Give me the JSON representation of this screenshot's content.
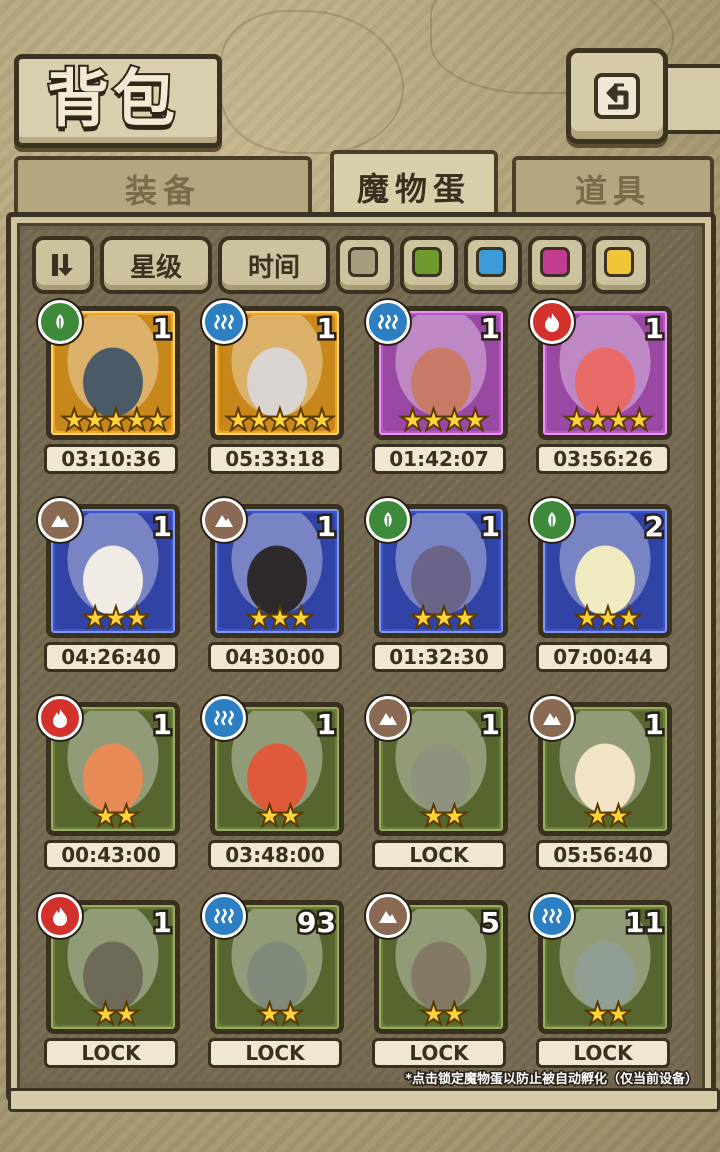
{
  "title": "背包",
  "tabs": [
    {
      "label": "装备",
      "active": false
    },
    {
      "label": "魔物蛋",
      "active": true
    },
    {
      "label": "道具",
      "active": false
    }
  ],
  "filters": {
    "sort_icon": "sort-toggle-icon",
    "star_label": "星级",
    "time_label": "时间",
    "swatches": [
      "#a89c80",
      "#6f9a2e",
      "#3d9bd8",
      "#c23c8f",
      "#f0c53a"
    ]
  },
  "eggs": [
    {
      "element": "nature",
      "rarity": "orange",
      "count": "1",
      "stars": 5,
      "timer": "03:10:36",
      "art": "#4a5a66"
    },
    {
      "element": "water",
      "rarity": "orange",
      "count": "1",
      "stars": 5,
      "timer": "05:33:18",
      "art": "#d9d4cf"
    },
    {
      "element": "water",
      "rarity": "purple",
      "count": "1",
      "stars": 4,
      "timer": "01:42:07",
      "art": "#c87a66"
    },
    {
      "element": "fire",
      "rarity": "purple",
      "count": "1",
      "stars": 4,
      "timer": "03:56:26",
      "art": "#e86a66"
    },
    {
      "element": "earth",
      "rarity": "blue",
      "count": "1",
      "stars": 3,
      "timer": "04:26:40",
      "art": "#f0ebe5"
    },
    {
      "element": "earth",
      "rarity": "blue",
      "count": "1",
      "stars": 3,
      "timer": "04:30:00",
      "art": "#2e2a2c"
    },
    {
      "element": "nature",
      "rarity": "blue",
      "count": "1",
      "stars": 3,
      "timer": "01:32:30",
      "art": "#6a6489"
    },
    {
      "element": "nature",
      "rarity": "blue",
      "count": "2",
      "stars": 3,
      "timer": "07:00:44",
      "art": "#efeac0"
    },
    {
      "element": "fire",
      "rarity": "green",
      "count": "1",
      "stars": 2,
      "timer": "00:43:00",
      "art": "#e88a55"
    },
    {
      "element": "water",
      "rarity": "green",
      "count": "1",
      "stars": 2,
      "timer": "03:48:00",
      "art": "#de5a3b"
    },
    {
      "element": "earth",
      "rarity": "green",
      "count": "1",
      "stars": 2,
      "timer": "LOCK",
      "art": "#8f917c"
    },
    {
      "element": "earth",
      "rarity": "green",
      "count": "1",
      "stars": 2,
      "timer": "05:56:40",
      "art": "#f3e3c5"
    },
    {
      "element": "fire",
      "rarity": "green",
      "count": "1",
      "stars": 2,
      "timer": "LOCK",
      "art": "#6d6a58"
    },
    {
      "element": "water",
      "rarity": "green",
      "count": "93",
      "stars": 2,
      "timer": "LOCK",
      "art": "#7f8a7a"
    },
    {
      "element": "earth",
      "rarity": "green",
      "count": "5",
      "stars": 2,
      "timer": "LOCK",
      "art": "#837a66"
    },
    {
      "element": "water",
      "rarity": "green",
      "count": "11",
      "stars": 2,
      "timer": "LOCK",
      "art": "#8e9e92"
    }
  ],
  "footnote": "*点击锁定魔物蛋以防止被自动孵化（仅当前设备）"
}
